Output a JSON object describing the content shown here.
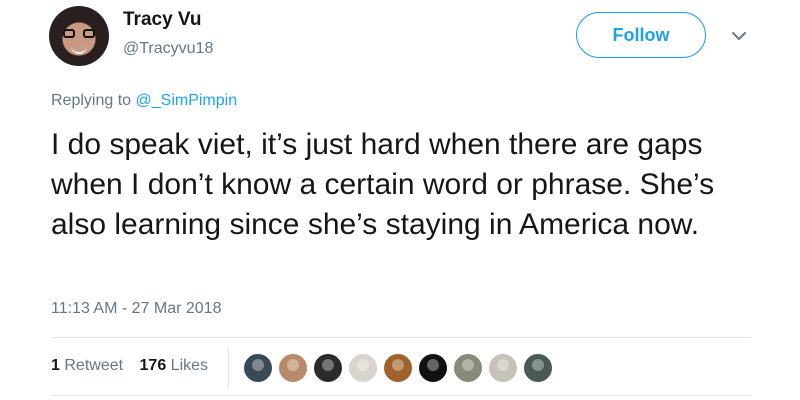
{
  "user": {
    "display_name": "Tracy Vu",
    "handle": "@Tracyvu18"
  },
  "follow": {
    "label": "Follow",
    "color": "#1da1f2"
  },
  "reply": {
    "prefix": "Replying to",
    "mention": "@_SimPimpin"
  },
  "tweet": {
    "text": "I do speak viet, it’s just hard when there are gaps when I don’t know a certain word or phrase. She’s also learning since she’s staying in America now.",
    "timestamp": "11:13 AM - 27 Mar 2018"
  },
  "stats": {
    "retweets_count": "1",
    "retweets_label": "Retweet",
    "likes_count": "176",
    "likes_label": "Likes"
  },
  "likers": [
    {
      "icon": "liker-avatar",
      "color": "#3a4a55"
    },
    {
      "icon": "liker-avatar",
      "color": "#b88a6a"
    },
    {
      "icon": "liker-avatar",
      "color": "#2b2b2b"
    },
    {
      "icon": "liker-avatar",
      "color": "#d9d4cc"
    },
    {
      "icon": "liker-avatar",
      "color": "#a0622c"
    },
    {
      "icon": "liker-avatar",
      "color": "#111111"
    },
    {
      "icon": "liker-avatar",
      "color": "#8a8a7a"
    },
    {
      "icon": "liker-avatar",
      "color": "#c7c2b8"
    },
    {
      "icon": "liker-avatar",
      "color": "#4a5a50"
    }
  ],
  "icons": {
    "menu": "chevron-down-icon",
    "avatar": "avatar"
  }
}
